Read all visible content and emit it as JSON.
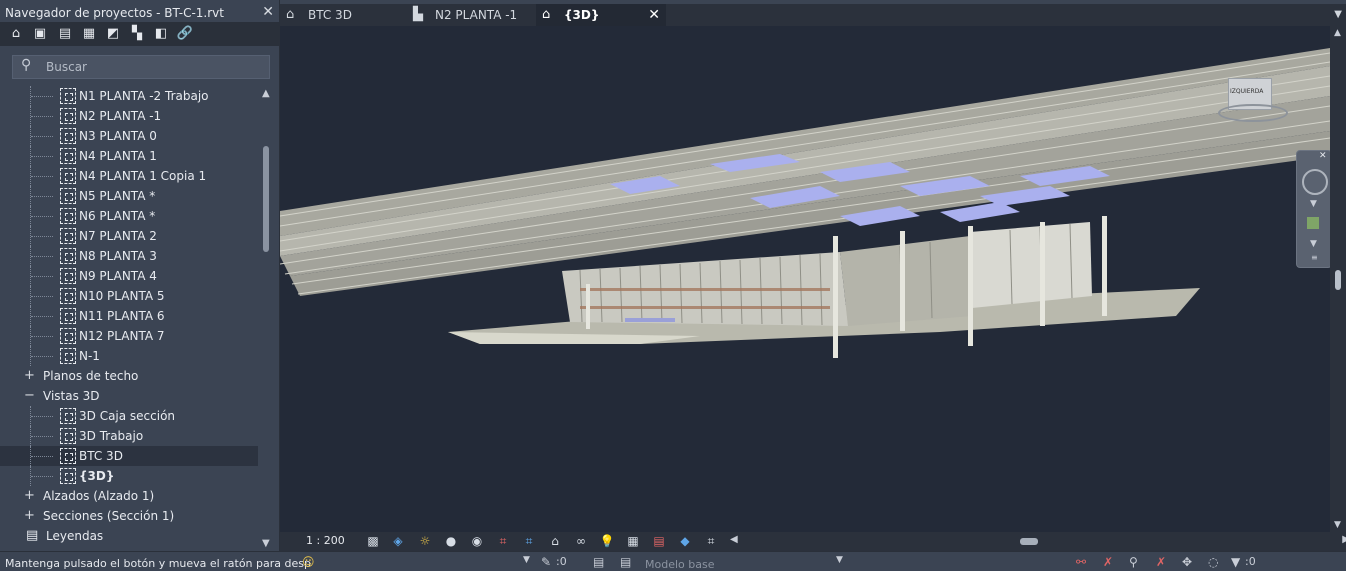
{
  "project_browser": {
    "title": "Navegador de proyectos - BT-C-1.rvt",
    "toolbar_icons": [
      "home-icon",
      "views-icon",
      "sheets-icon",
      "schedules-icon",
      "families-icon",
      "groups-icon",
      "revit-links-icon",
      "link-icon"
    ],
    "search_placeholder": "Buscar",
    "tree": [
      {
        "label": "N1 PLANTA -2 Trabajo",
        "level": 2
      },
      {
        "label": "N2 PLANTA -1",
        "level": 2
      },
      {
        "label": "N3 PLANTA 0",
        "level": 2
      },
      {
        "label": "N4 PLANTA 1",
        "level": 2
      },
      {
        "label": "N4 PLANTA 1 Copia 1",
        "level": 2
      },
      {
        "label": "N5 PLANTA *",
        "level": 2
      },
      {
        "label": "N6 PLANTA *",
        "level": 2
      },
      {
        "label": "N7 PLANTA 2",
        "level": 2
      },
      {
        "label": "N8 PLANTA 3",
        "level": 2
      },
      {
        "label": "N9 PLANTA 4",
        "level": 2
      },
      {
        "label": "N10 PLANTA 5",
        "level": 2
      },
      {
        "label": "N11 PLANTA 6",
        "level": 2
      },
      {
        "label": "N12 PLANTA 7",
        "level": 2
      },
      {
        "label": "N-1",
        "level": 2
      },
      {
        "label": "Planos de techo",
        "level": 1,
        "expander": "+"
      },
      {
        "label": "Vistas 3D",
        "level": 1,
        "expander": "−"
      },
      {
        "label": "3D Caja sección",
        "level": 2
      },
      {
        "label": "3D Trabajo",
        "level": 2
      },
      {
        "label": "BTC 3D",
        "level": 2,
        "selected": true
      },
      {
        "label": "{3D}",
        "level": 2,
        "bold": true
      },
      {
        "label": "Alzados (Alzado 1)",
        "level": 1,
        "expander": "+"
      },
      {
        "label": "Secciones (Sección 1)",
        "level": 1,
        "expander": "+"
      },
      {
        "label": "Leyendas",
        "level": 0
      }
    ]
  },
  "tabs": [
    {
      "label": "BTC 3D",
      "icon": "home-3d-icon",
      "active": false
    },
    {
      "label": "N2 PLANTA -1",
      "icon": "floor-plan-icon",
      "active": false
    },
    {
      "label": "{3D}",
      "icon": "home-3d-icon",
      "active": true
    }
  ],
  "viewcube_label": "IZQUIERDA",
  "view_control_bar": {
    "scale": "1 : 200"
  },
  "status": {
    "message": "Mantenga pulsado el botón y mueva el ratón para desp",
    "coord": ":0",
    "model": "Modelo base",
    "filter_count": ":0"
  }
}
